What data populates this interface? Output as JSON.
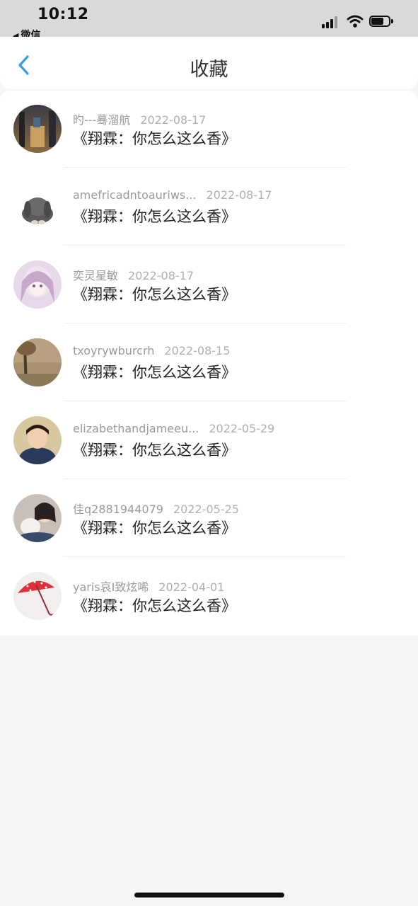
{
  "status_bar": {
    "time": "10:12",
    "back_app_label": "微信",
    "back_app_arrow": "◀"
  },
  "header": {
    "title": "收藏",
    "back_icon": "chevron-left-icon",
    "accent_color": "#3a9be0"
  },
  "items": [
    {
      "author": "旳---蓦溜航",
      "date": "2022-08-17",
      "title": "《翔霖：你怎么这么香》"
    },
    {
      "author": "amefricadntoauriws...",
      "date": "2022-08-17",
      "title": "《翔霖：你怎么这么香》"
    },
    {
      "author": "奕灵星敏",
      "date": "2022-08-17",
      "title": "《翔霖：你怎么这么香》"
    },
    {
      "author": "txoyrywburcrh",
      "date": "2022-08-15",
      "title": "《翔霖：你怎么这么香》"
    },
    {
      "author": "elizabethandjameeu...",
      "date": "2022-05-29",
      "title": "《翔霖：你怎么这么香》"
    },
    {
      "author": "佳q2881944079",
      "date": "2022-05-25",
      "title": "《翔霖：你怎么这么香》"
    },
    {
      "author": "yaris哀I致炫唏",
      "date": "2022-04-01",
      "title": "《翔霖：你怎么这么香》"
    }
  ]
}
